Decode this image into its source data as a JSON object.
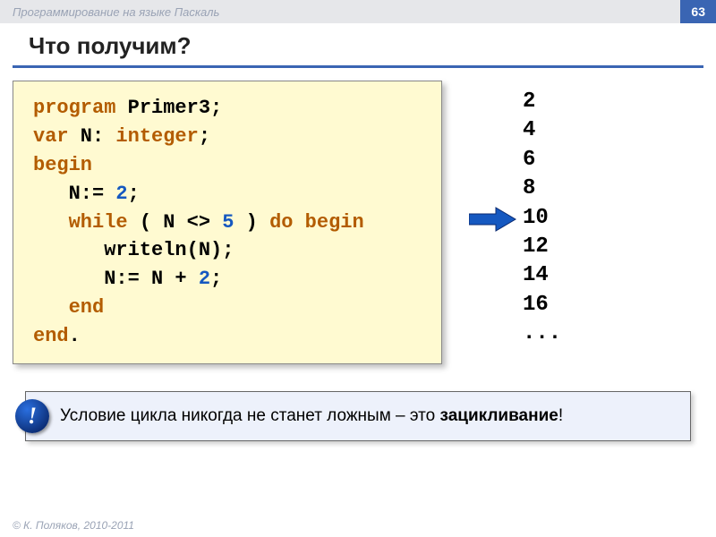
{
  "header": {
    "doc_title": "Программирование на языке Паскаль",
    "page_number": "63"
  },
  "title": "Что получим?",
  "code": {
    "l1_kw": "program",
    "l1_name": " Primer3;",
    "l2_kw": "var",
    "l2_rest": " N: ",
    "l2_type": "integer",
    "l2_semi": ";",
    "l3_kw": "begin",
    "l4_body": "   N:= ",
    "l4_num": "2",
    "l4_semi": ";",
    "l5_indent": "   ",
    "l5_while": "while",
    "l5_cond": " ( N <> ",
    "l5_num": "5",
    "l5_cond2": " ) ",
    "l5_do": "do begin",
    "l6_body": "      writeln(N);",
    "l7_body": "      N:= N + ",
    "l7_num": "2",
    "l7_semi": ";",
    "l8_indent": "   ",
    "l8_kw": "end",
    "l9_kw": "end",
    "l9_dot": "."
  },
  "output": [
    "2",
    "4",
    "6",
    "8",
    "10",
    "12",
    "14",
    "16",
    "..."
  ],
  "callout": {
    "badge": "!",
    "text_before": "Условие цикла никогда не станет ложным – это ",
    "text_bold": "зацикливание",
    "text_after": "!"
  },
  "footer": "© К. Поляков, 2010-2011"
}
